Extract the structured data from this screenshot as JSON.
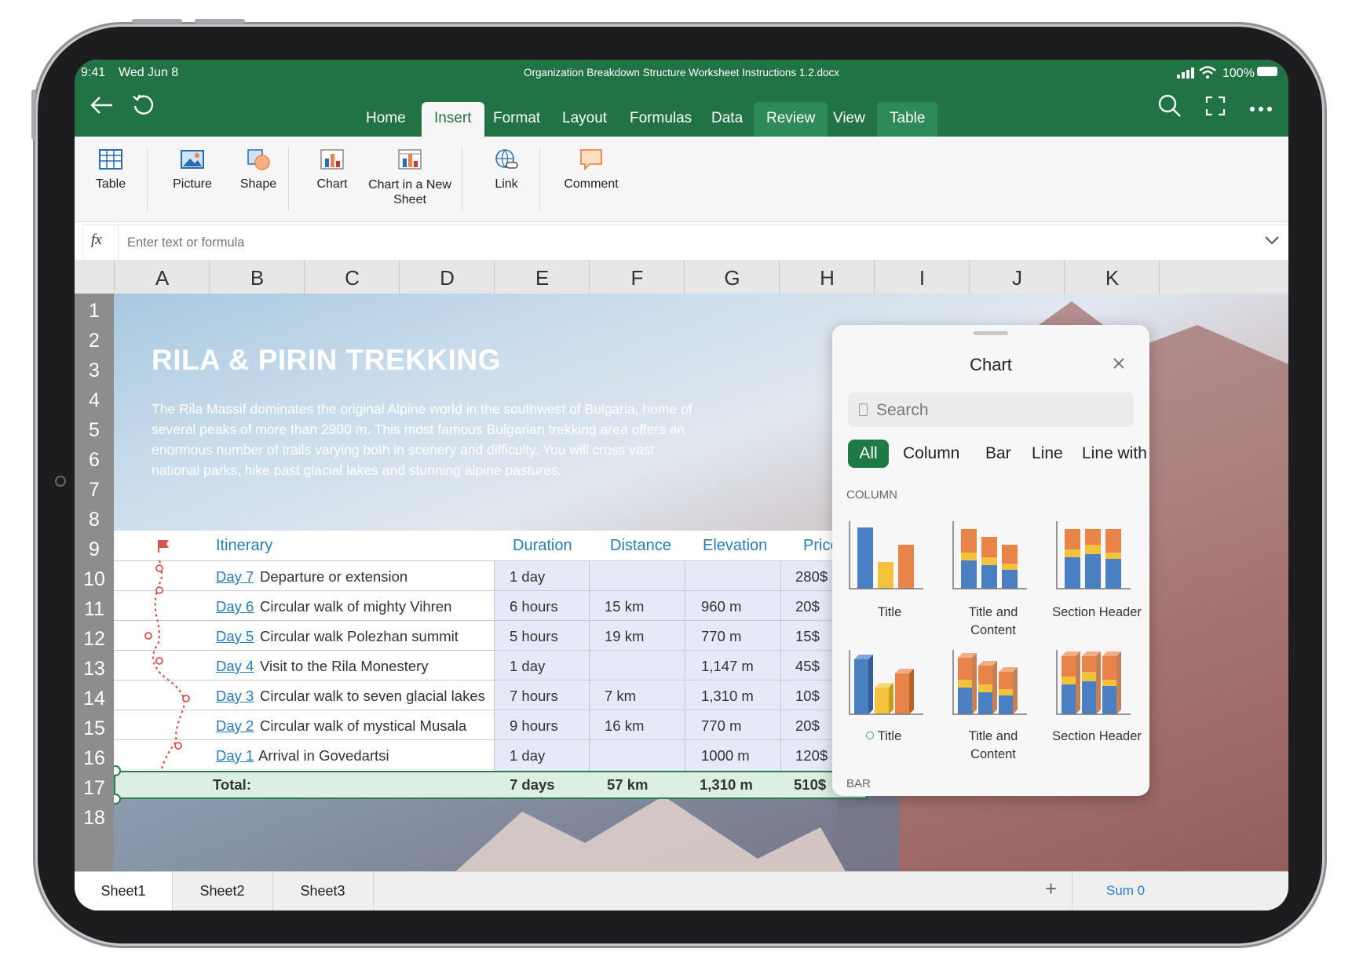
{
  "status": {
    "time": "9:41",
    "date": "Wed Jun 8",
    "doc_title": "Organization Breakdown Structure Worksheet Instructions 1.2.docx",
    "battery": "100%"
  },
  "toolbar": {
    "back_icon": "back-arrow-icon",
    "undo_icon": "undo-icon",
    "search_icon": "search-icon",
    "expand_icon": "expand-icon",
    "more_icon": "more-icon"
  },
  "tabs": [
    "Home",
    "Insert",
    "Format",
    "Layout",
    "Formulas",
    "Data",
    "Review",
    "View",
    "Table"
  ],
  "active_tab": "Insert",
  "ribbon": [
    {
      "label": "Table",
      "icon": "table-icon"
    },
    {
      "label": "Picture",
      "icon": "picture-icon"
    },
    {
      "label": "Shape",
      "icon": "shape-icon"
    },
    {
      "label": "Chart",
      "icon": "chart-icon"
    },
    {
      "label": "Chart in a New Sheet",
      "icon": "chart-new-sheet-icon"
    },
    {
      "label": "Link",
      "icon": "link-icon"
    },
    {
      "label": "Comment",
      "icon": "comment-icon"
    }
  ],
  "formula": {
    "fx": "fx",
    "placeholder": "Enter text or formula"
  },
  "columns": [
    "A",
    "B",
    "C",
    "D",
    "E",
    "F",
    "G",
    "H",
    "I",
    "J",
    "K"
  ],
  "rows": [
    "1",
    "2",
    "3",
    "4",
    "5",
    "6",
    "7",
    "8",
    "9",
    "10",
    "11",
    "12",
    "13",
    "14",
    "15",
    "16",
    "17",
    "18"
  ],
  "sheet": {
    "title": "RILA & PIRIN TREKKING",
    "intro": "The Rila Massif dominates the original Alpine world in the southwest of Bulgaria, home of several peaks of more than 2900 m. This most famous Bulgarian trekking area offers an enormous number of trails varying both in scenery and difficulty. You will cross vast national parks, hike past glacial lakes and stunning alpine pastures.",
    "headers": {
      "itinerary": "Itinerary",
      "duration": "Duration",
      "distance": "Distance",
      "elevation": "Elevation",
      "price": "Price"
    },
    "rows": [
      {
        "day": "Day 7",
        "desc": "Departure or extension",
        "duration": "1 day",
        "distance": "",
        "elevation": "",
        "price": "280$"
      },
      {
        "day": "Day 6",
        "desc": "Circular walk of mighty Vihren",
        "duration": "6 hours",
        "distance": "15 km",
        "elevation": "960 m",
        "price": "20$"
      },
      {
        "day": "Day 5",
        "desc": "Circular walk Polezhan summit",
        "duration": "5 hours",
        "distance": "19 km",
        "elevation": "770 m",
        "price": "15$"
      },
      {
        "day": "Day 4",
        "desc": "Visit to the Rila Monestery",
        "duration": "1 day",
        "distance": "",
        "elevation": "1,147 m",
        "price": "45$"
      },
      {
        "day": "Day 3",
        "desc": "Circular walk to seven glacial lakes",
        "duration": "7 hours",
        "distance": "7 km",
        "elevation": "1,310 m",
        "price": "10$"
      },
      {
        "day": "Day 2",
        "desc": "Circular walk of mystical Musala",
        "duration": "9 hours",
        "distance": "16 km",
        "elevation": "770 m",
        "price": "20$"
      },
      {
        "day": "Day 1",
        "desc": "Arrival in Govedartsi",
        "duration": "1 day",
        "distance": "",
        "elevation": "1000 m",
        "price": "120$"
      }
    ],
    "total": {
      "label": "Total:",
      "duration": "7 days",
      "distance": "57 km",
      "elevation": "1,310 m",
      "price": "510$"
    }
  },
  "chart_panel": {
    "title": "Chart",
    "search_placeholder": "Search",
    "filters": [
      "All",
      "Column",
      "Bar",
      "Line",
      "Line with"
    ],
    "active_filter": "All",
    "section_column": "COLUMN",
    "section_bar": "BAR",
    "thumbs_row1": [
      "Title",
      "Title and Content",
      "Section Header"
    ],
    "thumbs_row2": [
      "Title",
      "Title and Content",
      "Section Header"
    ],
    "colors": {
      "blue": "#4a7fc1",
      "orange": "#e8844a",
      "yellow": "#f2c23c"
    }
  },
  "sheet_tabs": [
    "Sheet1",
    "Sheet2",
    "Sheet3"
  ],
  "add_sheet": "+",
  "sum": "Sum 0"
}
